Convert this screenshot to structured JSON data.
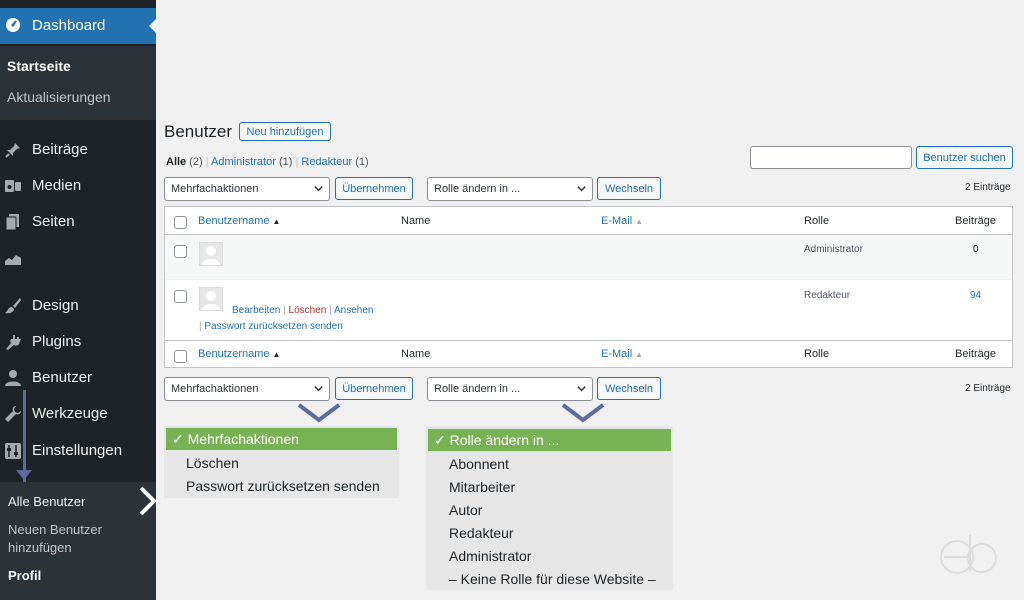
{
  "sidebar": {
    "dashboard": "Dashboard",
    "sub_dashboard": [
      "Startseite",
      "Aktualisierungen"
    ],
    "items": [
      {
        "label": "Beiträge",
        "icon": "pin-icon"
      },
      {
        "label": "Medien",
        "icon": "media-icon"
      },
      {
        "label": "Seiten",
        "icon": "pages-icon"
      },
      {
        "label": "",
        "icon": "chart-icon"
      },
      {
        "label": "Design",
        "icon": "brush-icon"
      },
      {
        "label": "Plugins",
        "icon": "plugin-icon"
      },
      {
        "label": "Benutzer",
        "icon": "user-icon"
      },
      {
        "label": "Werkzeuge",
        "icon": "wrench-icon"
      },
      {
        "label": "Einstellungen",
        "icon": "settings-icon"
      }
    ],
    "sub_users": [
      "Alle Benutzer",
      "Neuen Benutzer",
      "hinzufügen",
      "Profil"
    ]
  },
  "main": {
    "title": "Benutzer",
    "add_new": "Neu hinzufügen",
    "filters": {
      "all": "Alle",
      "all_count": "(2)",
      "admin": "Administrator",
      "admin_count": "(1)",
      "editor": "Redakteur",
      "editor_count": "(1)",
      "separator": "|"
    },
    "search_button": "Benutzer suchen",
    "bulk_select": "Mehrfachaktionen",
    "apply": "Übernehmen",
    "role_select": "Rolle ändern in ...",
    "change": "Wechseln",
    "count": "2 Einträge"
  },
  "table": {
    "headers": {
      "username": "Benutzername",
      "name": "Name",
      "email": "E-Mail",
      "role": "Rolle",
      "posts": "Beiträge"
    },
    "rows": [
      {
        "role": "Administrator",
        "posts": "0"
      },
      {
        "role": "Redakteur",
        "posts": "94"
      }
    ],
    "row_actions": {
      "edit": "Bearbeiten",
      "delete": "Löschen",
      "view": "Ansehen",
      "reset": "Passwort zurücksetzen senden",
      "sep": "|"
    }
  },
  "dropdown_bulk": {
    "selected": "✓ Mehrfachaktionen",
    "options": [
      "Löschen",
      "Passwort zurücksetzen senden"
    ]
  },
  "dropdown_role": {
    "selected": "✓ Rolle ändern in ...",
    "options": [
      "Abonnent",
      "Mitarbeiter",
      "Autor",
      "Redakteur",
      "Administrator",
      "– Keine Rolle für diese Website –"
    ]
  },
  "colors": {
    "accent": "#2271b1",
    "sidebar": "#1d2327",
    "highlight": "#77b255",
    "delete": "#b32d2e",
    "arrow": "#5e6a9a"
  }
}
